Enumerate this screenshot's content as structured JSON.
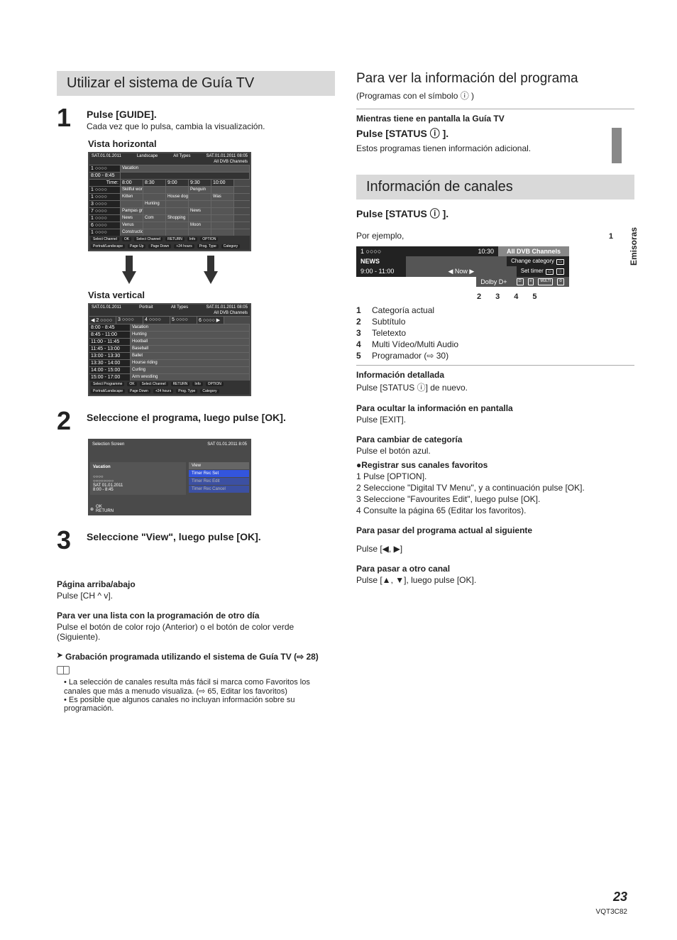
{
  "side": {
    "tab": "Emisoras"
  },
  "footer": {
    "page": "23",
    "code": "VQT3C82"
  },
  "left": {
    "title": "Utilizar el sistema de Guía TV",
    "step1": {
      "num": "1",
      "head": "Pulse [GUIDE].",
      "body": "Cada vez que lo pulsa, cambia la visualización.",
      "vistaH": "Vista horizontal",
      "vistaV": "Vista vertical"
    },
    "step2": {
      "num": "2",
      "head": "Seleccione el programa, luego pulse [OK]."
    },
    "step3": {
      "num": "3",
      "head": "Seleccione \"View\", luego pulse [OK]."
    },
    "pagina": {
      "h": "Página arriba/abajo",
      "p": "Pulse [CH ^ v]."
    },
    "otro_dia": {
      "h": "Para ver una lista con la programación de otro día",
      "p": "Pulse el botón de color rojo (Anterior) o el botón de color verde (Siguiente)."
    },
    "grab": "Grabación programada utilizando el sistema de Guía TV (⇨ 28)",
    "notes": [
      "La selección de canales resulta más fácil si marca como Favoritos los canales que más a menudo visualiza. (⇨ 65, Editar los favoritos)",
      "Es posible que algunos canales no incluyan información sobre su programación."
    ],
    "tvH": {
      "date": "SAT.01.01.2011",
      "time": "08:05",
      "view": "Landscape",
      "types": "All Types",
      "chlabel": "All DVB Channels",
      "topch": "1 ○○○○",
      "topprog": "Vacation",
      "toptime": "8:00 - 8:45",
      "header_time_label": "Time:",
      "times": [
        "8:00",
        "8:30",
        "9:00",
        "9:30",
        "10:00"
      ],
      "rows": [
        {
          "ch": "1 ○○○○",
          "progs": [
            "Skillful workman",
            "",
            "",
            "Penguin",
            ""
          ]
        },
        {
          "ch": "1 ○○○○",
          "progs": [
            "Kitten",
            "",
            "House dog",
            "",
            "Was"
          ]
        },
        {
          "ch": "3 ○○○○",
          "progs": [
            "",
            "Hunting",
            "",
            "",
            ""
          ]
        },
        {
          "ch": "7 ○○○○",
          "progs": [
            "Pampas grass",
            "",
            "",
            "News",
            ""
          ]
        },
        {
          "ch": "1 ○○○○",
          "progs": [
            "News",
            "Com",
            "Shopping",
            "",
            ""
          ]
        },
        {
          "ch": "6 ○○○○",
          "progs": [
            "Venus",
            "",
            "",
            "Moon",
            ""
          ]
        },
        {
          "ch": "1 ○○○○",
          "progs": [
            "Construction",
            "",
            "",
            "",
            ""
          ]
        }
      ],
      "footer": [
        "Select Channel",
        "OK",
        "Select Channel",
        "RETURN",
        "Info",
        "OPTION",
        "Portrait/Landscape",
        "Page Up",
        "Page Down",
        "+24 hours",
        "Prog. Type",
        "Category"
      ]
    },
    "tvV": {
      "date": "SAT.01.01.2011",
      "time": "08:05",
      "view": "Portrait",
      "types": "All Types",
      "chlabel": "All DVB Channels",
      "chs": [
        "◀ 2 ○○○○",
        "3 ○○○○",
        "4 ○○○○",
        "5 ○○○○",
        "6 ○○○○ ▶"
      ],
      "rows": [
        {
          "t": "8:00 - 8:45",
          "p": "Vacation"
        },
        {
          "t": "8:45 - 11:00",
          "p": "Hunting"
        },
        {
          "t": "11:00 - 11:45",
          "p": "Hootball"
        },
        {
          "t": "11:45 - 13:00",
          "p": "Baseball"
        },
        {
          "t": "13:00 - 13:30",
          "p": "Ballet"
        },
        {
          "t": "13:30 - 14:00",
          "p": "Hourse riding"
        },
        {
          "t": "14:00 - 15:00",
          "p": "Curling"
        },
        {
          "t": "15:00 - 17:00",
          "p": "Arm wrestling"
        }
      ],
      "footer": [
        "Select Programme",
        "OK",
        "Select Channel",
        "RETURN",
        "Info",
        "OPTION",
        "Portrait/Landscape",
        "Page Down",
        "+24 hours",
        "Prog. Type",
        "Category"
      ]
    },
    "sel": {
      "title": "Selection Screen",
      "date": "SAT 01.01.2011 8:05",
      "prog": "Vacation",
      "l1": "○○○○",
      "l2": "○○○○○○○○",
      "l3": "SAT 01.01.2011",
      "l4": "8:00 - 8:45",
      "r0": "View",
      "r1": "Timer Rec Set",
      "r2": "Timer Rec Edit",
      "r3": "Timer Rec Cancel",
      "ok": "OK",
      "ret": "RETURN"
    }
  },
  "right": {
    "para_ver": {
      "title": "Para ver la información del programa",
      "sub": "(Programas con el símbolo ⓘ )",
      "while": "Mientras tiene en pantalla la Guía TV",
      "status": "Pulse [STATUS ⓘ ].",
      "body": "Estos programas tienen información adicional."
    },
    "info_ch": {
      "title": "Información de canales",
      "status": "Pulse [STATUS ⓘ ].",
      "por": "Por ejemplo,",
      "callout1": "1",
      "callouts_bottom": [
        "2",
        "3",
        "4",
        "5"
      ],
      "box": {
        "ch": "1 ○○○○",
        "time": "10:30",
        "cat": "All DVB Channels",
        "prog": "NEWS",
        "slot": "9:00 - 11:00",
        "now": "◀ Now ▶",
        "chg": "Change category",
        "set": "Set timer",
        "dolby": "Dolby D+"
      },
      "legend": [
        {
          "n": "1",
          "t": "Categoría actual"
        },
        {
          "n": "2",
          "t": "Subtítulo"
        },
        {
          "n": "3",
          "t": "Teletexto"
        },
        {
          "n": "4",
          "t": "Multi Vídeo/Multi Audio"
        },
        {
          "n": "5",
          "t": "Programador (⇨ 30)"
        }
      ],
      "det_h": "Información detallada",
      "det_p": "Pulse [STATUS ⓘ] de nuevo.",
      "ocultar_h": "Para ocultar la información en pantalla",
      "ocultar_p": "Pulse [EXIT].",
      "camb_h": "Para cambiar de categoría",
      "camb_p": "Pulse el botón azul.",
      "fav_h": "●Registrar sus canales favoritos",
      "fav_steps": [
        "1 Pulse [OPTION].",
        "2 Seleccione \"Digital TV Menu\", y a continuación pulse [OK].",
        "3 Seleccione \"Favourites Edit\", luego pulse [OK].",
        "4 Consulte la página 65 (Editar los favoritos)."
      ],
      "siguiente_h": "Para pasar del programa actual al siguiente",
      "siguiente_p": "Pulse [◀, ▶]",
      "otro_h": "Para pasar a otro canal",
      "otro_p": "Pulse [▲, ▼], luego pulse [OK]."
    }
  }
}
